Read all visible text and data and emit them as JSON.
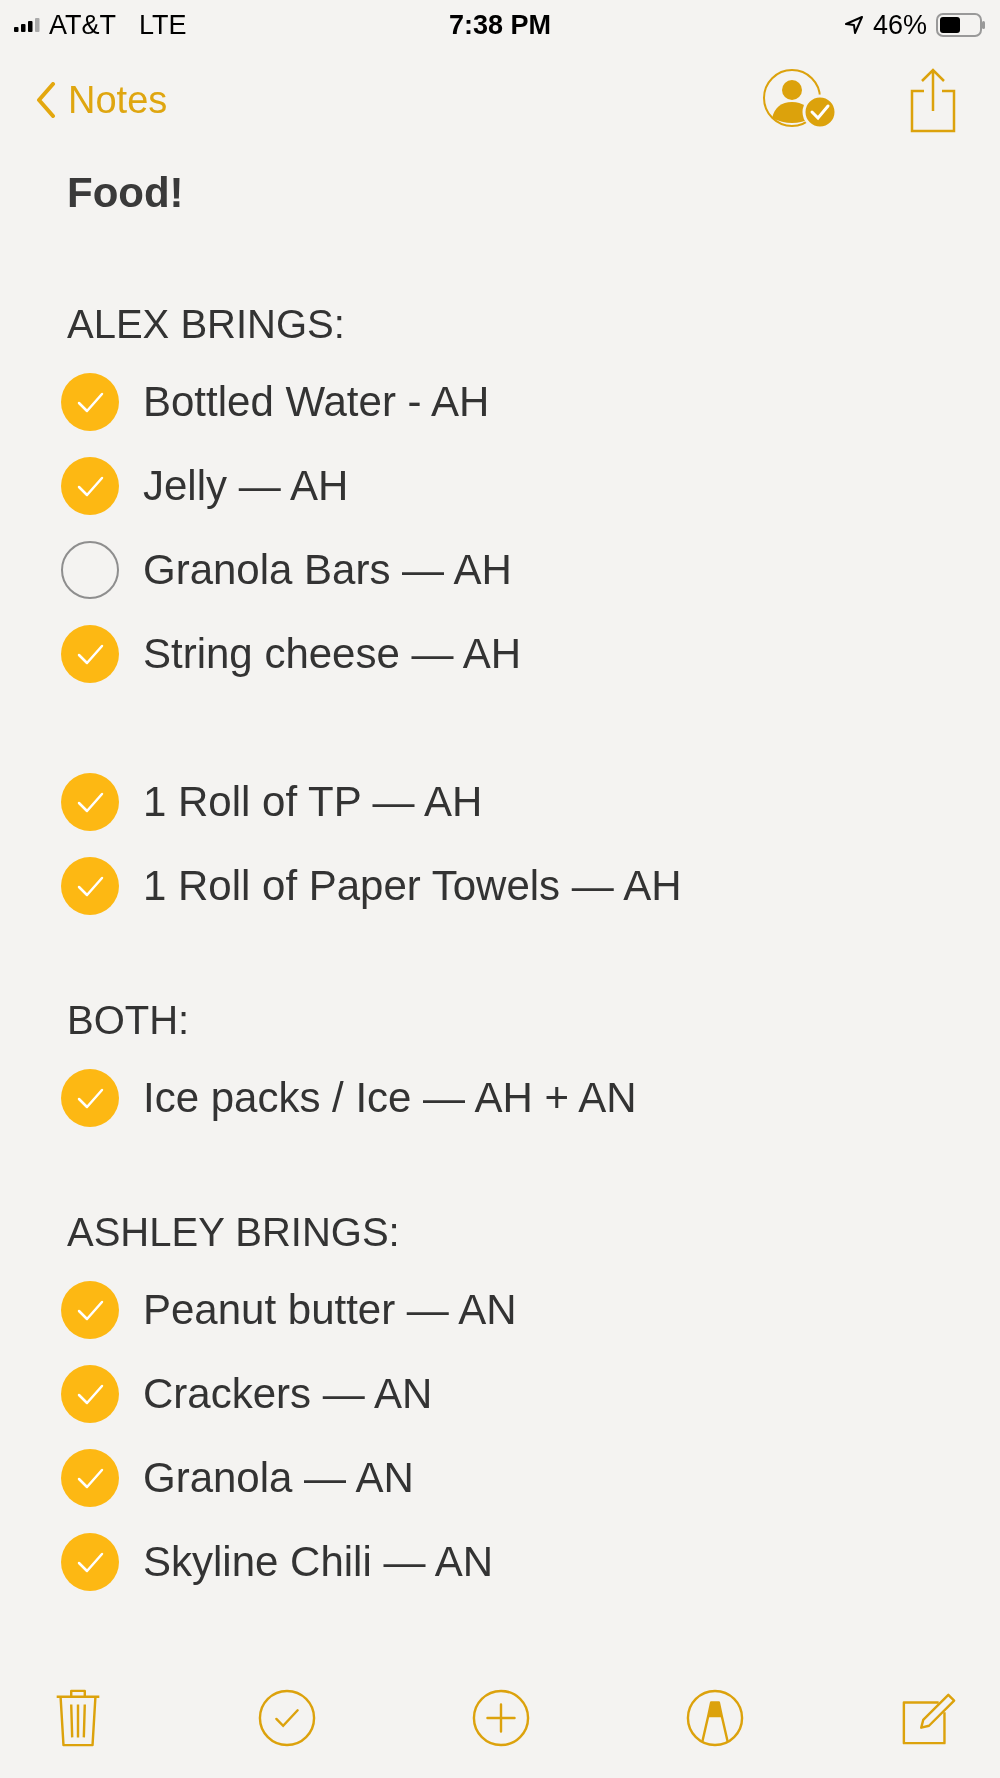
{
  "status_bar": {
    "carrier": "AT&T",
    "network": "LTE",
    "time": "7:38 PM",
    "battery": "46%"
  },
  "nav": {
    "back": "Notes"
  },
  "note": {
    "title": "Food!",
    "blocks": [
      {
        "kind": "heading",
        "text": "ALEX BRINGS:"
      },
      {
        "kind": "check",
        "text": "Bottled Water - AH",
        "checked": true
      },
      {
        "kind": "check",
        "text": "Jelly — AH",
        "checked": true
      },
      {
        "kind": "check",
        "text": "Granola Bars — AH",
        "checked": false
      },
      {
        "kind": "check",
        "text": "String cheese — AH",
        "checked": true
      },
      {
        "kind": "blank"
      },
      {
        "kind": "check",
        "text": "1 Roll of TP — AH",
        "checked": true
      },
      {
        "kind": "check",
        "text": "1 Roll of Paper Towels — AH",
        "checked": true
      },
      {
        "kind": "heading",
        "text": "BOTH:"
      },
      {
        "kind": "check",
        "text": "Ice packs / Ice — AH + AN",
        "checked": true
      },
      {
        "kind": "heading",
        "text": "ASHLEY BRINGS:"
      },
      {
        "kind": "check",
        "text": "Peanut butter — AN",
        "checked": true
      },
      {
        "kind": "check",
        "text": "Crackers — AN",
        "checked": true
      },
      {
        "kind": "check",
        "text": "Granola — AN",
        "checked": true
      },
      {
        "kind": "check",
        "text": "Skyline Chili — AN",
        "checked": true
      }
    ]
  }
}
